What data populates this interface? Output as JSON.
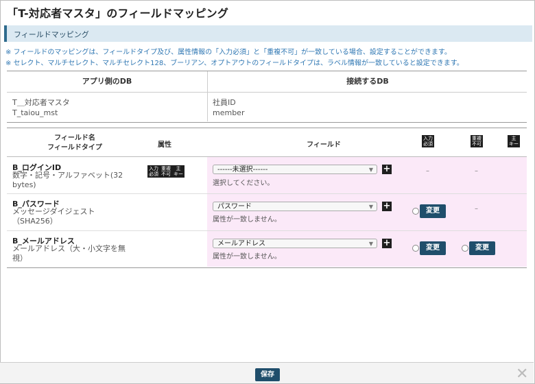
{
  "title": "「T-対応者マスタ」のフィールドマッピング",
  "section": "フィールドマッピング",
  "notes": [
    "※ フィールドのマッピングは、フィールドタイプ及び、属性情報の「入力必須」と「重複不可」が一致している場合、設定することができます。",
    "※ セレクト、マルチセレクト、マルチセレクト128、ブーリアン、オプトアウトのフィールドタイプは、ラベル情報が一致していると設定できます。"
  ],
  "db": {
    "app_header": "アプリ側のDB",
    "conn_header": "接続するDB",
    "app_name": "T＿対応者マスタ",
    "app_code": "T_taiou_mst",
    "conn_name": "社員ID",
    "conn_code": "member"
  },
  "map_headers": {
    "field_name": "フィールド名",
    "field_type": "フィールドタイプ",
    "attr": "属性",
    "field": "フィールド",
    "icon_required_1": "入力",
    "icon_required_2": "必須",
    "icon_unique_1": "重複",
    "icon_unique_2": "不可",
    "icon_key_1": "主",
    "icon_key_2": "キー"
  },
  "rows": [
    {
      "name": "B_ログインID",
      "type": "数字・記号・アルファベット(32 bytes)",
      "select": "------未選択------",
      "hint": "選択してください。",
      "dash1": "–",
      "dash2": "–"
    },
    {
      "name": "B_パスワード",
      "type": "メッセージダイジェスト（SHA256）",
      "select": "パスワード",
      "hint": "属性が一致しません。",
      "btn1": "変更",
      "dash2": "–"
    },
    {
      "name": "B_メールアドレス",
      "type": "メールアドレス（大・小文字を無視）",
      "select": "メールアドレス",
      "hint": "属性が一致しません。",
      "btn1": "変更",
      "btn2": "変更"
    }
  ],
  "plus_icon": "+",
  "save_label": "保存",
  "close_icon": "✕"
}
